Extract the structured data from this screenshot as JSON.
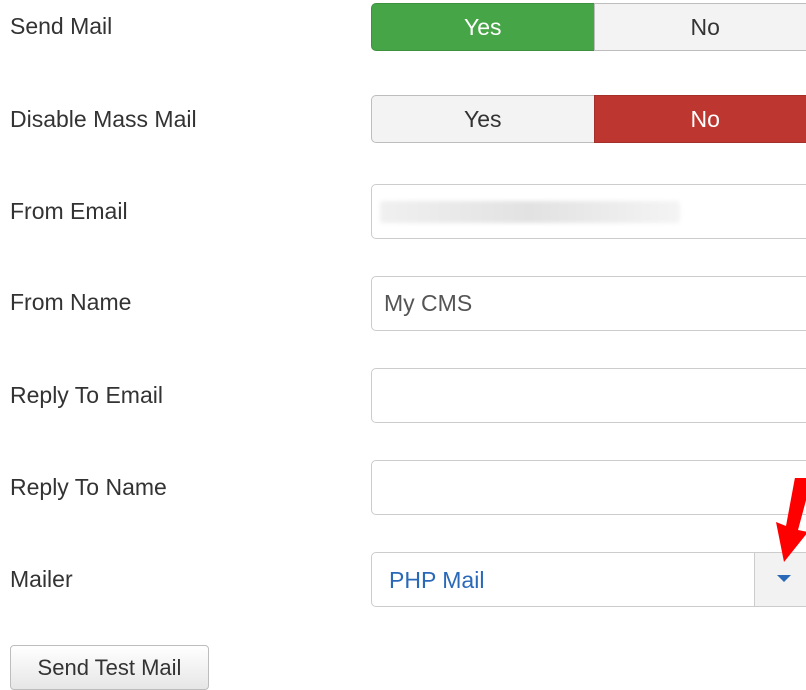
{
  "send_mail": {
    "label": "Send Mail",
    "yes": "Yes",
    "no": "No",
    "selected": "Yes"
  },
  "mass_mail": {
    "label": "Disable Mass Mail",
    "yes": "Yes",
    "no": "No",
    "selected": "No"
  },
  "from_email": {
    "label": "From Email",
    "value": ""
  },
  "from_name": {
    "label": "From Name",
    "value": "My CMS"
  },
  "reply_email": {
    "label": "Reply To Email",
    "value": ""
  },
  "reply_name": {
    "label": "Reply To Name",
    "value": ""
  },
  "mailer": {
    "label": "Mailer",
    "value": "PHP Mail"
  },
  "test_button": {
    "label": "Send Test Mail"
  },
  "colors": {
    "yes_active": "#46a546",
    "no_active": "#bd362f",
    "link": "#2a69b8",
    "arrow": "#ff0000"
  },
  "icons": {
    "dropdown": "chevron-down-icon",
    "annotation": "red-arrow-icon"
  }
}
